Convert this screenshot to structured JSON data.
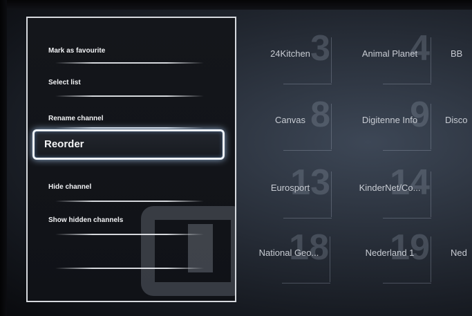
{
  "menu": {
    "items": [
      {
        "label": "Mark as favourite"
      },
      {
        "label": "Select list"
      },
      {
        "label": "Rename channel"
      },
      {
        "label": "Reorder"
      },
      {
        "label": "Hide channel"
      },
      {
        "label": "Show hidden channels"
      }
    ],
    "selected_index": 3
  },
  "channels": [
    {
      "name": "24Kitchen",
      "number": "3"
    },
    {
      "name": "Animal Planet",
      "number": "4"
    },
    {
      "name": "BB",
      "number": ""
    },
    {
      "name": "Canvas",
      "number": "8"
    },
    {
      "name": "Digitenne Info",
      "number": "9"
    },
    {
      "name": "Disco",
      "number": ""
    },
    {
      "name": "Eurosport",
      "number": "13"
    },
    {
      "name": "KinderNet/Co...",
      "number": "14"
    },
    {
      "name": "",
      "number": ""
    },
    {
      "name": "National Geo...",
      "number": "18"
    },
    {
      "name": "Nederland 1",
      "number": "19"
    },
    {
      "name": "Ned",
      "number": ""
    }
  ],
  "colors": {
    "panel_border": "#d7dadf",
    "selection_glow": "#b4d7ff",
    "channel_text": "#c8ccd3"
  }
}
